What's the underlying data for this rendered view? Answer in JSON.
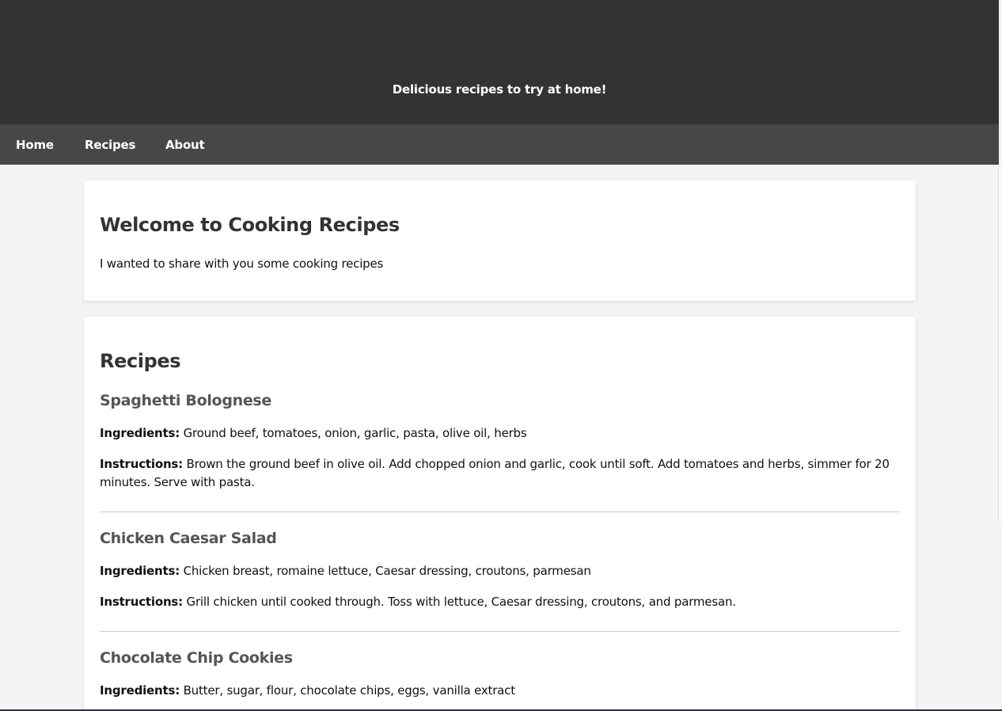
{
  "header": {
    "tagline": "Delicious recipes to try at home!"
  },
  "nav": {
    "items": [
      {
        "label": "Home"
      },
      {
        "label": "Recipes"
      },
      {
        "label": "About"
      }
    ]
  },
  "welcome": {
    "title": "Welcome to Cooking Recipes",
    "text": "I wanted to share with you some cooking recipes"
  },
  "recipes": {
    "title": "Recipes",
    "ingredients_label": "Ingredients:",
    "instructions_label": "Instructions:",
    "items": [
      {
        "name": "Spaghetti Bolognese",
        "ingredients": "Ground beef, tomatoes, onion, garlic, pasta, olive oil, herbs",
        "instructions": "Brown the ground beef in olive oil. Add chopped onion and garlic, cook until soft. Add tomatoes and herbs, simmer for 20 minutes. Serve with pasta."
      },
      {
        "name": "Chicken Caesar Salad",
        "ingredients": "Chicken breast, romaine lettuce, Caesar dressing, croutons, parmesan",
        "instructions": "Grill chicken until cooked through. Toss with lettuce, Caesar dressing, croutons, and parmesan."
      },
      {
        "name": "Chocolate Chip Cookies",
        "ingredients": "Butter, sugar, flour, chocolate chips, eggs, vanilla extract"
      }
    ]
  },
  "colors": {
    "header_bg": "#333333",
    "nav_bg": "#474747",
    "page_bg": "#f4f4f7",
    "card_bg": "#ffffff",
    "heading": "#333333",
    "subheading": "#555555"
  }
}
